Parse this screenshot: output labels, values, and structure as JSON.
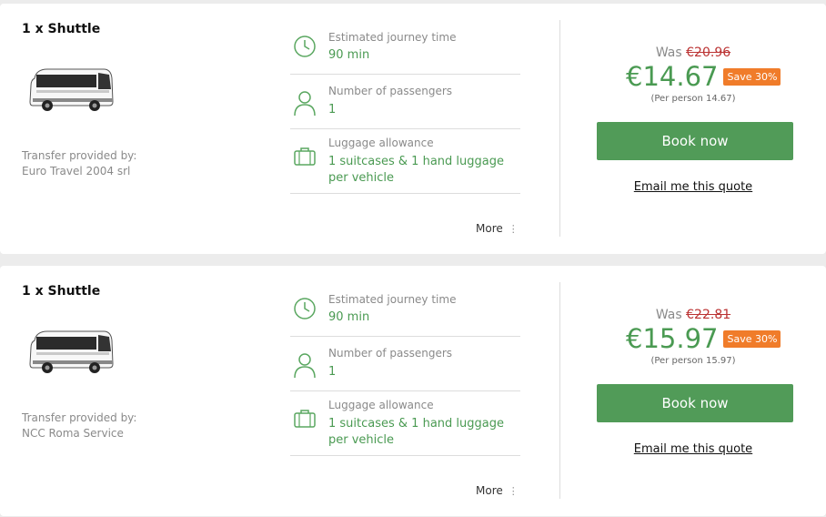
{
  "results": [
    {
      "title": "1 x Shuttle",
      "provider_label": "Transfer provided by:",
      "provider_name": "Euro Travel 2004 srl",
      "journey_label": "Estimated journey time",
      "journey_value": "90 min",
      "passengers_label": "Number of passengers",
      "passengers_value": "1",
      "luggage_label": "Luggage allowance",
      "luggage_value": "1 suitcases & 1 hand luggage per vehicle",
      "more_label": "More",
      "was_label": "Was",
      "old_price": "€20.96",
      "price": "€14.67",
      "save_badge": "Save 30%",
      "per_person": "(Per person 14.67)",
      "book_label": "Book now",
      "email_label": "Email me this quote"
    },
    {
      "title": "1 x Shuttle",
      "provider_label": "Transfer provided by:",
      "provider_name": "NCC Roma Service",
      "journey_label": "Estimated journey time",
      "journey_value": "90 min",
      "passengers_label": "Number of passengers",
      "passengers_value": "1",
      "luggage_label": "Luggage allowance",
      "luggage_value": "1 suitcases & 1 hand luggage per vehicle",
      "more_label": "More",
      "was_label": "Was",
      "old_price": "€22.81",
      "price": "€15.97",
      "save_badge": "Save 30%",
      "per_person": "(Per person 15.97)",
      "book_label": "Book now",
      "email_label": "Email me this quote"
    }
  ],
  "icons": {
    "journey": "clock-icon",
    "passengers": "person-icon",
    "luggage": "luggage-icon",
    "vehicle": "bus-image",
    "more": "vertical-dots-icon"
  },
  "colors": {
    "accent_green": "#519b58",
    "value_green": "#4a9a52",
    "save_orange": "#f07c2a",
    "old_price_red": "#b33333"
  }
}
